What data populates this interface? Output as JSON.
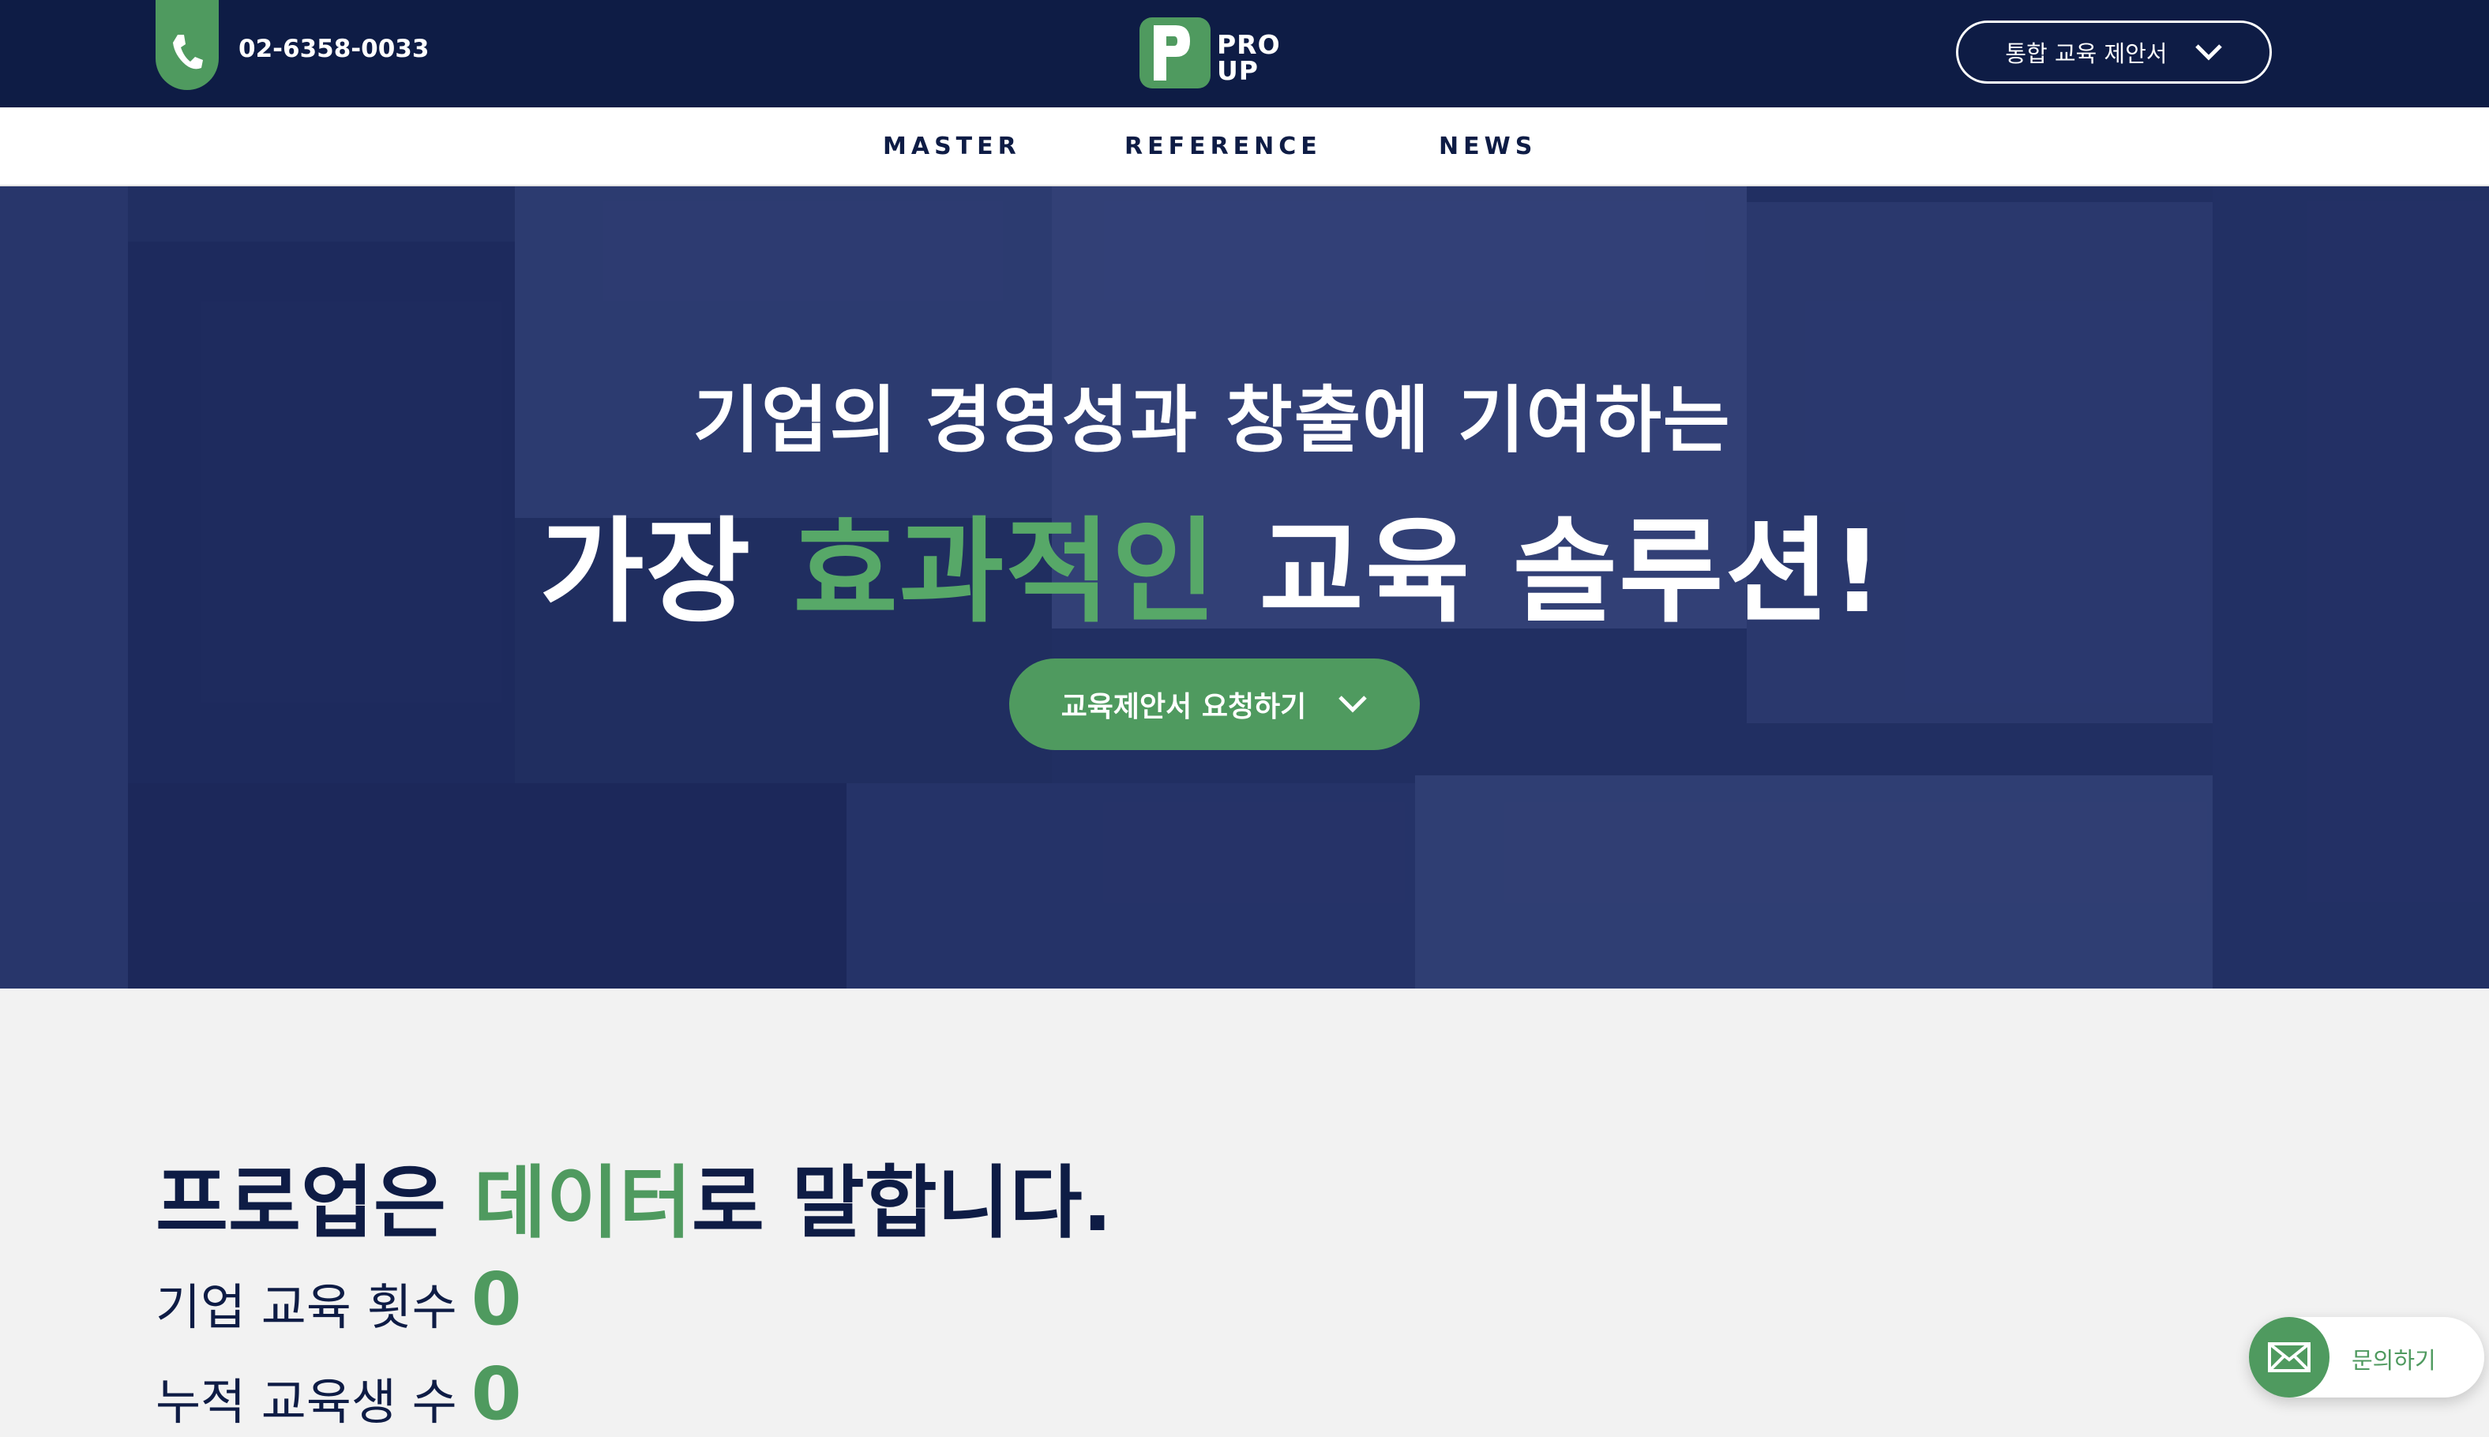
{
  "header": {
    "phone": "02-6358-0033",
    "logo_line1": "PRO",
    "logo_line2": "UP",
    "proposal_button": "통합 교육 제안서"
  },
  "nav": {
    "items": [
      {
        "label": "MASTER"
      },
      {
        "label": "REFERENCE"
      },
      {
        "label": "NEWS"
      }
    ]
  },
  "hero": {
    "line1": "기업의 경영성과 창출에 기여하는",
    "line2_pre": "가장",
    "line2_accent": "효과적인",
    "line2_post": "교육 솔루션!",
    "cta": "교육제안서 요청하기"
  },
  "stats_section": {
    "headline_pre": "프로업은",
    "headline_accent": "데이터",
    "headline_post": "로 말합니다.",
    "stats": [
      {
        "label": "기업 교육 횟수",
        "value": "0"
      },
      {
        "label": "누적 교육생 수",
        "value": "0"
      }
    ]
  },
  "contact_button": "문의하기",
  "colors": {
    "navy": "#0e1c45",
    "green": "#4f9a5f",
    "hero_tint": "#2c3a6e"
  }
}
